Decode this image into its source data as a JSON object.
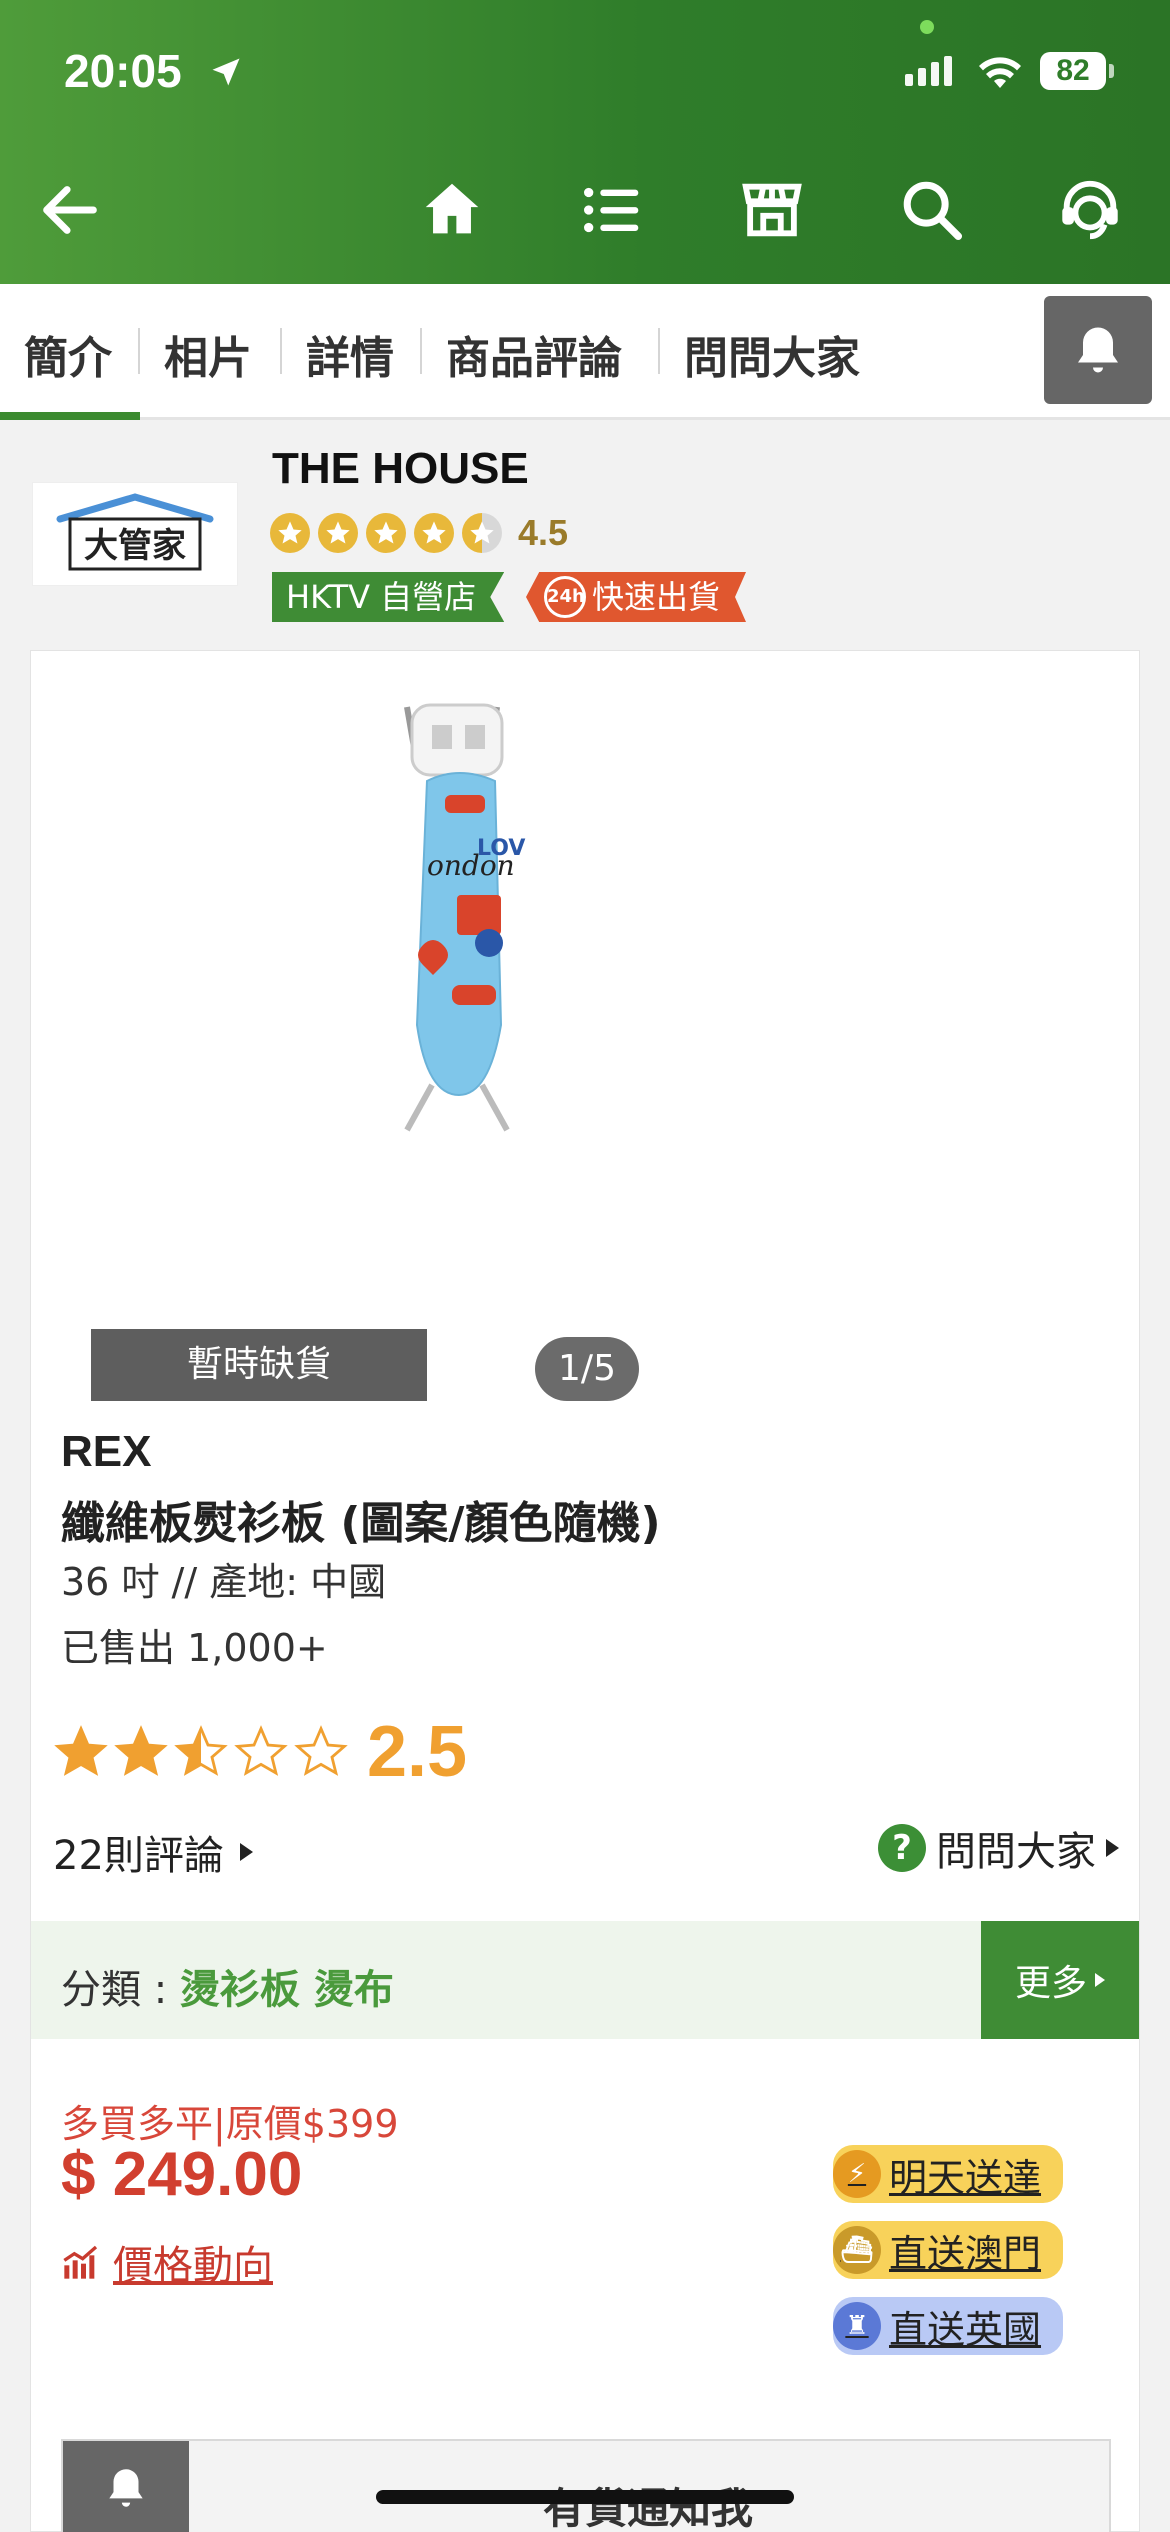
{
  "status_bar": {
    "time": "20:05",
    "battery": "82"
  },
  "nav": {
    "icons": [
      "back-arrow-icon",
      "home-icon",
      "menu-list-icon",
      "store-icon",
      "search-icon",
      "customer-service-icon"
    ]
  },
  "tabs": [
    {
      "label": "簡介",
      "active": true
    },
    {
      "label": "相片"
    },
    {
      "label": "詳情"
    },
    {
      "label": "商品評論"
    },
    {
      "label": "問問大家"
    }
  ],
  "store": {
    "logo_text": "大管家",
    "name": "THE HOUSE",
    "rating": "4.5",
    "badge_official": "HKTV 自營店",
    "badge_fast_icon": "24h",
    "badge_fast": "快速出貨"
  },
  "product": {
    "status_label": "暫時缺貨",
    "pager": "1/5",
    "brand": "REX",
    "name": "纖維板熨衫板 (圖案/顏色隨機)",
    "spec": "36 吋 // 產地: 中國",
    "sold": "已售出 1,000+",
    "rating_value": 2.5,
    "rating_text": "2.5",
    "reviews": "22則評論",
    "ask": "問問大家",
    "category_label": "分類 : ",
    "category_value": "燙衫板 燙布",
    "more": "更多",
    "promo": "多買多平|原價$399",
    "price": "$ 249.00",
    "price_trend": "價格動向",
    "delivery": [
      "明天送達",
      "直送澳門",
      "直送英國"
    ],
    "notify": "有貨通知我"
  },
  "colors": {
    "brand_green": "#3f8c35",
    "price_red": "#d13f2f",
    "rating_orange": "#f0a030"
  }
}
